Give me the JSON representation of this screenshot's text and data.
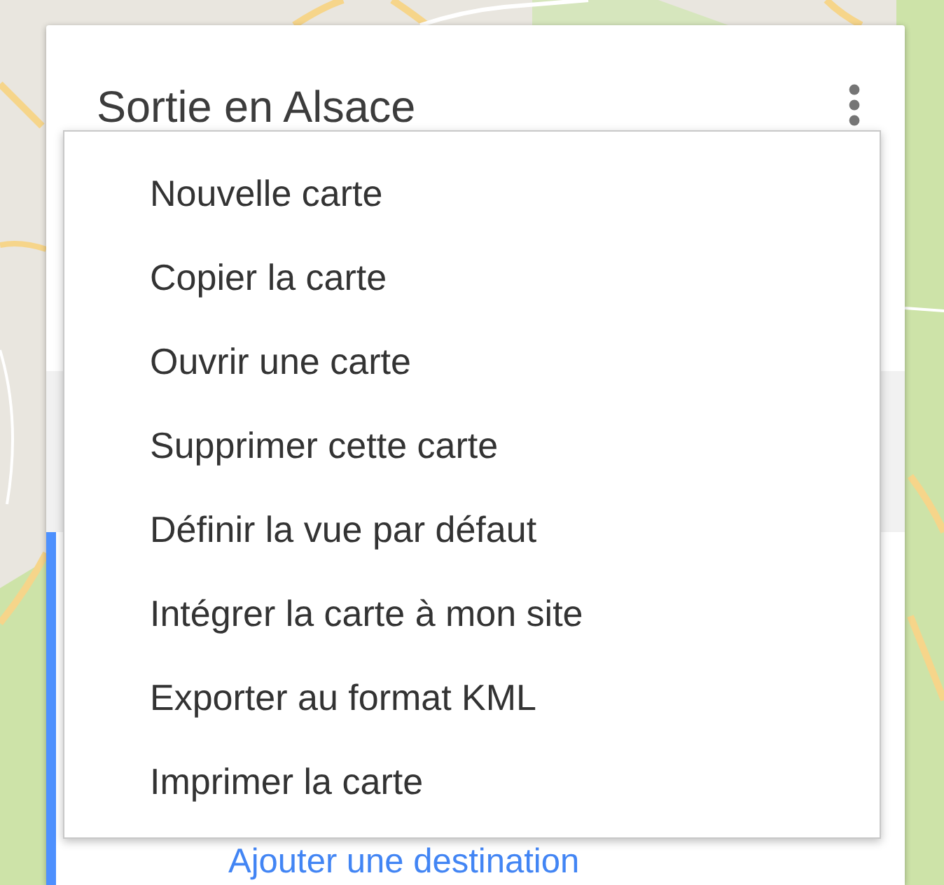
{
  "card": {
    "title": "Sortie en Alsace"
  },
  "menu": {
    "items": [
      {
        "label": "Nouvelle carte"
      },
      {
        "label": "Copier la carte"
      },
      {
        "label": "Ouvrir une carte"
      },
      {
        "label": "Supprimer cette carte"
      },
      {
        "label": "Définir la vue par défaut"
      },
      {
        "label": "Intégrer la carte à mon site"
      },
      {
        "label": "Exporter au format KML"
      },
      {
        "label": "Imprimer la carte"
      }
    ]
  },
  "layer": {
    "link": "Ajouter une destination"
  }
}
